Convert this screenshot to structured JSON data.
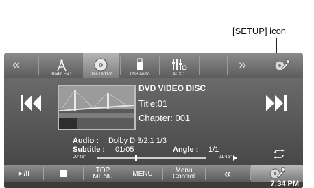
{
  "callout": {
    "label": "[SETUP] icon"
  },
  "sources": [
    {
      "label": "Radio FM1",
      "icon": "radio-tower-icon"
    },
    {
      "label": "Disc DVD-V",
      "icon": "disc-icon",
      "active": true
    },
    {
      "label": "USB Audio",
      "icon": "usb-icon"
    },
    {
      "label": "AUX-1",
      "icon": "aux-icon"
    }
  ],
  "nav": {
    "left_chevron": "«",
    "right_chevron": "»"
  },
  "disc": {
    "type": "DVD VIDEO DISC",
    "title": "Title:01",
    "chapter": "Chapter: 001"
  },
  "playback": {
    "audio_label": "Audio :",
    "audio_value": "Dolby D 3/2.1 1/3",
    "subtitle_label": "Subtitle :",
    "subtitle_value": "01/05",
    "angle_label": "Angle :",
    "angle_value": "1/1",
    "elapsed": "00'45\"",
    "remaining": "01'46\"",
    "progress_fraction": 0.35
  },
  "controls": {
    "play_pause": "►/II",
    "top_menu": "TOP MENU",
    "menu": "MENU",
    "menu_control": "Menu Control",
    "back": "«"
  },
  "clock": "7:34 PM",
  "colors": {
    "screen_bg": "#4a4a4a",
    "bar_bg": "#7a7a7a",
    "text": "#ffffff"
  }
}
